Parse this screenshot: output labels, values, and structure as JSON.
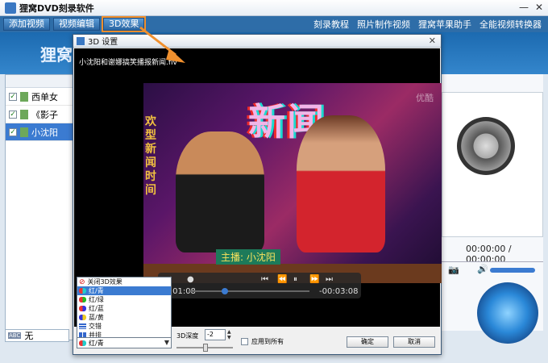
{
  "app": {
    "title": "狸窝DVD刻录软件"
  },
  "toolbar": {
    "add_video": "添加视频",
    "edit_video": "视频编辑",
    "effect_3d": "3D效果",
    "links": [
      "刻录教程",
      "照片制作视频",
      "狸窝苹果助手",
      "全能视频转换器"
    ]
  },
  "banner": {
    "text": "狸窝"
  },
  "files": [
    {
      "label": "西单女",
      "checked": true
    },
    {
      "label": "《影子",
      "checked": true
    },
    {
      "label": "小沈阳",
      "checked": true
    }
  ],
  "subtitle": {
    "value": "无"
  },
  "preview": {
    "timecode": "00:00:00 / 00:00:00"
  },
  "dialog": {
    "title": "3D 设置",
    "filename": "小沈阳和谢娜搞笑播报新闻.flv",
    "video": {
      "headline": "新闻",
      "side_text": "欢型新闻时间",
      "caption": "主播: 小沈阳",
      "watermark": "优酷"
    },
    "player": {
      "time_current": "00:01:08",
      "time_remaining": "-00:03:08",
      "progress": 0.27
    },
    "modes": [
      "关闭3D效果",
      "红/青",
      "红/绿",
      "红/蓝",
      "蓝/黄",
      "交错",
      "并排"
    ],
    "selected_mode": "红/青",
    "depth_label": "3D深度",
    "depth_value": "-2",
    "apply_all_label": "应用到所有",
    "ok_label": "确定",
    "cancel_label": "取消"
  },
  "colors": {
    "accent": "#2e6da8",
    "highlight": "#f0902e",
    "selection": "#3b7bd1"
  }
}
